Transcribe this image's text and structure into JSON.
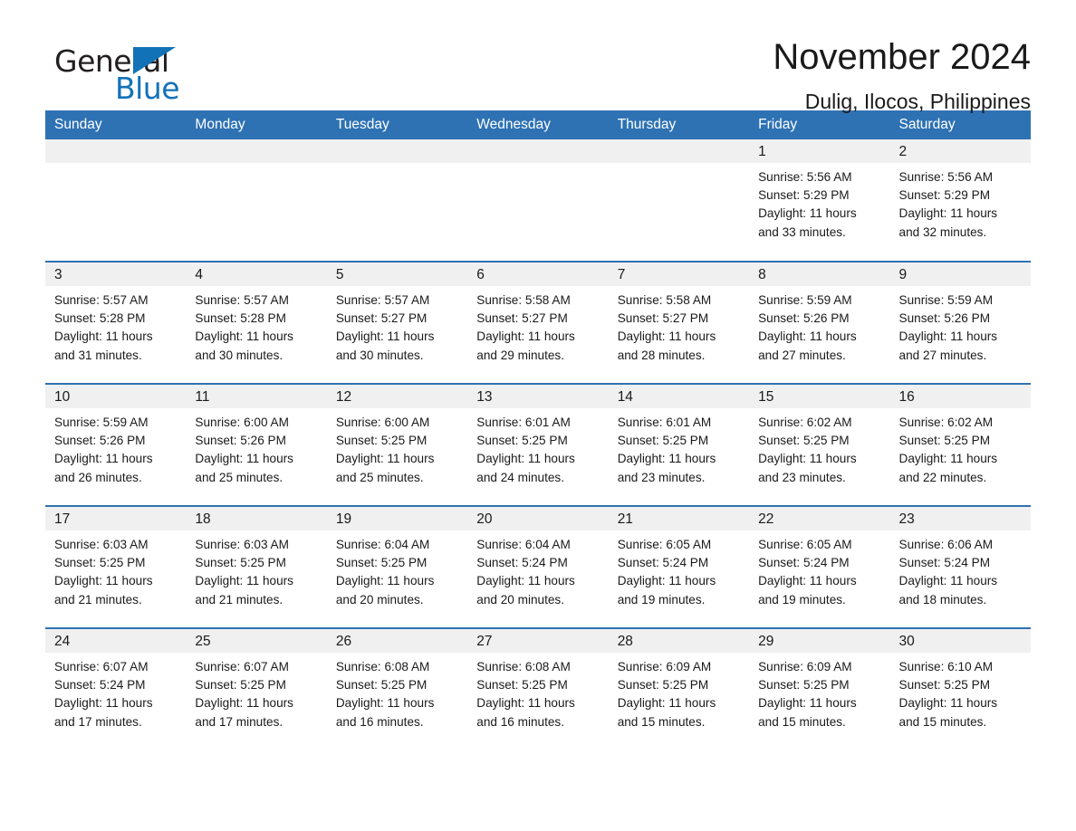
{
  "brand": {
    "name_part1": "General",
    "name_part2": "Blue",
    "triangle_color": "#1272b8",
    "accent_color": "#2e72b3"
  },
  "header": {
    "title": "November 2024",
    "subtitle": "Dulig, Ilocos, Philippines"
  },
  "weekdays": [
    "Sunday",
    "Monday",
    "Tuesday",
    "Wednesday",
    "Thursday",
    "Friday",
    "Saturday"
  ],
  "labels": {
    "sunrise": "Sunrise:",
    "sunset": "Sunset:",
    "daylight": "Daylight:"
  },
  "weeks": [
    [
      {
        "day": "",
        "sunrise": "",
        "sunset": "",
        "daylight_line1": "",
        "daylight_line2": ""
      },
      {
        "day": "",
        "sunrise": "",
        "sunset": "",
        "daylight_line1": "",
        "daylight_line2": ""
      },
      {
        "day": "",
        "sunrise": "",
        "sunset": "",
        "daylight_line1": "",
        "daylight_line2": ""
      },
      {
        "day": "",
        "sunrise": "",
        "sunset": "",
        "daylight_line1": "",
        "daylight_line2": ""
      },
      {
        "day": "",
        "sunrise": "",
        "sunset": "",
        "daylight_line1": "",
        "daylight_line2": ""
      },
      {
        "day": "1",
        "sunrise": "Sunrise: 5:56 AM",
        "sunset": "Sunset: 5:29 PM",
        "daylight_line1": "Daylight: 11 hours",
        "daylight_line2": "and 33 minutes."
      },
      {
        "day": "2",
        "sunrise": "Sunrise: 5:56 AM",
        "sunset": "Sunset: 5:29 PM",
        "daylight_line1": "Daylight: 11 hours",
        "daylight_line2": "and 32 minutes."
      }
    ],
    [
      {
        "day": "3",
        "sunrise": "Sunrise: 5:57 AM",
        "sunset": "Sunset: 5:28 PM",
        "daylight_line1": "Daylight: 11 hours",
        "daylight_line2": "and 31 minutes."
      },
      {
        "day": "4",
        "sunrise": "Sunrise: 5:57 AM",
        "sunset": "Sunset: 5:28 PM",
        "daylight_line1": "Daylight: 11 hours",
        "daylight_line2": "and 30 minutes."
      },
      {
        "day": "5",
        "sunrise": "Sunrise: 5:57 AM",
        "sunset": "Sunset: 5:27 PM",
        "daylight_line1": "Daylight: 11 hours",
        "daylight_line2": "and 30 minutes."
      },
      {
        "day": "6",
        "sunrise": "Sunrise: 5:58 AM",
        "sunset": "Sunset: 5:27 PM",
        "daylight_line1": "Daylight: 11 hours",
        "daylight_line2": "and 29 minutes."
      },
      {
        "day": "7",
        "sunrise": "Sunrise: 5:58 AM",
        "sunset": "Sunset: 5:27 PM",
        "daylight_line1": "Daylight: 11 hours",
        "daylight_line2": "and 28 minutes."
      },
      {
        "day": "8",
        "sunrise": "Sunrise: 5:59 AM",
        "sunset": "Sunset: 5:26 PM",
        "daylight_line1": "Daylight: 11 hours",
        "daylight_line2": "and 27 minutes."
      },
      {
        "day": "9",
        "sunrise": "Sunrise: 5:59 AM",
        "sunset": "Sunset: 5:26 PM",
        "daylight_line1": "Daylight: 11 hours",
        "daylight_line2": "and 27 minutes."
      }
    ],
    [
      {
        "day": "10",
        "sunrise": "Sunrise: 5:59 AM",
        "sunset": "Sunset: 5:26 PM",
        "daylight_line1": "Daylight: 11 hours",
        "daylight_line2": "and 26 minutes."
      },
      {
        "day": "11",
        "sunrise": "Sunrise: 6:00 AM",
        "sunset": "Sunset: 5:26 PM",
        "daylight_line1": "Daylight: 11 hours",
        "daylight_line2": "and 25 minutes."
      },
      {
        "day": "12",
        "sunrise": "Sunrise: 6:00 AM",
        "sunset": "Sunset: 5:25 PM",
        "daylight_line1": "Daylight: 11 hours",
        "daylight_line2": "and 25 minutes."
      },
      {
        "day": "13",
        "sunrise": "Sunrise: 6:01 AM",
        "sunset": "Sunset: 5:25 PM",
        "daylight_line1": "Daylight: 11 hours",
        "daylight_line2": "and 24 minutes."
      },
      {
        "day": "14",
        "sunrise": "Sunrise: 6:01 AM",
        "sunset": "Sunset: 5:25 PM",
        "daylight_line1": "Daylight: 11 hours",
        "daylight_line2": "and 23 minutes."
      },
      {
        "day": "15",
        "sunrise": "Sunrise: 6:02 AM",
        "sunset": "Sunset: 5:25 PM",
        "daylight_line1": "Daylight: 11 hours",
        "daylight_line2": "and 23 minutes."
      },
      {
        "day": "16",
        "sunrise": "Sunrise: 6:02 AM",
        "sunset": "Sunset: 5:25 PM",
        "daylight_line1": "Daylight: 11 hours",
        "daylight_line2": "and 22 minutes."
      }
    ],
    [
      {
        "day": "17",
        "sunrise": "Sunrise: 6:03 AM",
        "sunset": "Sunset: 5:25 PM",
        "daylight_line1": "Daylight: 11 hours",
        "daylight_line2": "and 21 minutes."
      },
      {
        "day": "18",
        "sunrise": "Sunrise: 6:03 AM",
        "sunset": "Sunset: 5:25 PM",
        "daylight_line1": "Daylight: 11 hours",
        "daylight_line2": "and 21 minutes."
      },
      {
        "day": "19",
        "sunrise": "Sunrise: 6:04 AM",
        "sunset": "Sunset: 5:25 PM",
        "daylight_line1": "Daylight: 11 hours",
        "daylight_line2": "and 20 minutes."
      },
      {
        "day": "20",
        "sunrise": "Sunrise: 6:04 AM",
        "sunset": "Sunset: 5:24 PM",
        "daylight_line1": "Daylight: 11 hours",
        "daylight_line2": "and 20 minutes."
      },
      {
        "day": "21",
        "sunrise": "Sunrise: 6:05 AM",
        "sunset": "Sunset: 5:24 PM",
        "daylight_line1": "Daylight: 11 hours",
        "daylight_line2": "and 19 minutes."
      },
      {
        "day": "22",
        "sunrise": "Sunrise: 6:05 AM",
        "sunset": "Sunset: 5:24 PM",
        "daylight_line1": "Daylight: 11 hours",
        "daylight_line2": "and 19 minutes."
      },
      {
        "day": "23",
        "sunrise": "Sunrise: 6:06 AM",
        "sunset": "Sunset: 5:24 PM",
        "daylight_line1": "Daylight: 11 hours",
        "daylight_line2": "and 18 minutes."
      }
    ],
    [
      {
        "day": "24",
        "sunrise": "Sunrise: 6:07 AM",
        "sunset": "Sunset: 5:24 PM",
        "daylight_line1": "Daylight: 11 hours",
        "daylight_line2": "and 17 minutes."
      },
      {
        "day": "25",
        "sunrise": "Sunrise: 6:07 AM",
        "sunset": "Sunset: 5:25 PM",
        "daylight_line1": "Daylight: 11 hours",
        "daylight_line2": "and 17 minutes."
      },
      {
        "day": "26",
        "sunrise": "Sunrise: 6:08 AM",
        "sunset": "Sunset: 5:25 PM",
        "daylight_line1": "Daylight: 11 hours",
        "daylight_line2": "and 16 minutes."
      },
      {
        "day": "27",
        "sunrise": "Sunrise: 6:08 AM",
        "sunset": "Sunset: 5:25 PM",
        "daylight_line1": "Daylight: 11 hours",
        "daylight_line2": "and 16 minutes."
      },
      {
        "day": "28",
        "sunrise": "Sunrise: 6:09 AM",
        "sunset": "Sunset: 5:25 PM",
        "daylight_line1": "Daylight: 11 hours",
        "daylight_line2": "and 15 minutes."
      },
      {
        "day": "29",
        "sunrise": "Sunrise: 6:09 AM",
        "sunset": "Sunset: 5:25 PM",
        "daylight_line1": "Daylight: 11 hours",
        "daylight_line2": "and 15 minutes."
      },
      {
        "day": "30",
        "sunrise": "Sunrise: 6:10 AM",
        "sunset": "Sunset: 5:25 PM",
        "daylight_line1": "Daylight: 11 hours",
        "daylight_line2": "and 15 minutes."
      }
    ]
  ]
}
